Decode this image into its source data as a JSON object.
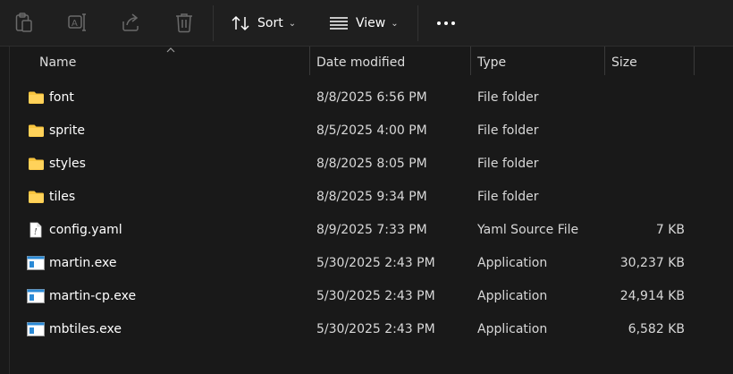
{
  "toolbar": {
    "sort_label": "Sort",
    "view_label": "View"
  },
  "columns": {
    "name": "Name",
    "date": "Date modified",
    "type": "Type",
    "size": "Size"
  },
  "files": [
    {
      "name": "font",
      "date": "8/8/2025 6:56 PM",
      "type": "File folder",
      "size": "",
      "icon": "folder-icon"
    },
    {
      "name": "sprite",
      "date": "8/5/2025 4:00 PM",
      "type": "File folder",
      "size": "",
      "icon": "folder-icon"
    },
    {
      "name": "styles",
      "date": "8/8/2025 8:05 PM",
      "type": "File folder",
      "size": "",
      "icon": "folder-icon"
    },
    {
      "name": "tiles",
      "date": "8/8/2025 9:34 PM",
      "type": "File folder",
      "size": "",
      "icon": "folder-icon"
    },
    {
      "name": "config.yaml",
      "date": "8/9/2025 7:33 PM",
      "type": "Yaml Source File",
      "size": "7 KB",
      "icon": "file-icon"
    },
    {
      "name": "martin.exe",
      "date": "5/30/2025 2:43 PM",
      "type": "Application",
      "size": "30,237 KB",
      "icon": "application-icon"
    },
    {
      "name": "martin-cp.exe",
      "date": "5/30/2025 2:43 PM",
      "type": "Application",
      "size": "24,914 KB",
      "icon": "application-icon"
    },
    {
      "name": "mbtiles.exe",
      "date": "5/30/2025 2:43 PM",
      "type": "Application",
      "size": "6,582 KB",
      "icon": "application-icon"
    }
  ],
  "colors": {
    "background": "#191919",
    "toolbar": "#1f1f1f",
    "folder": "#f8c43e",
    "app_icon": "#2b8ad6"
  }
}
